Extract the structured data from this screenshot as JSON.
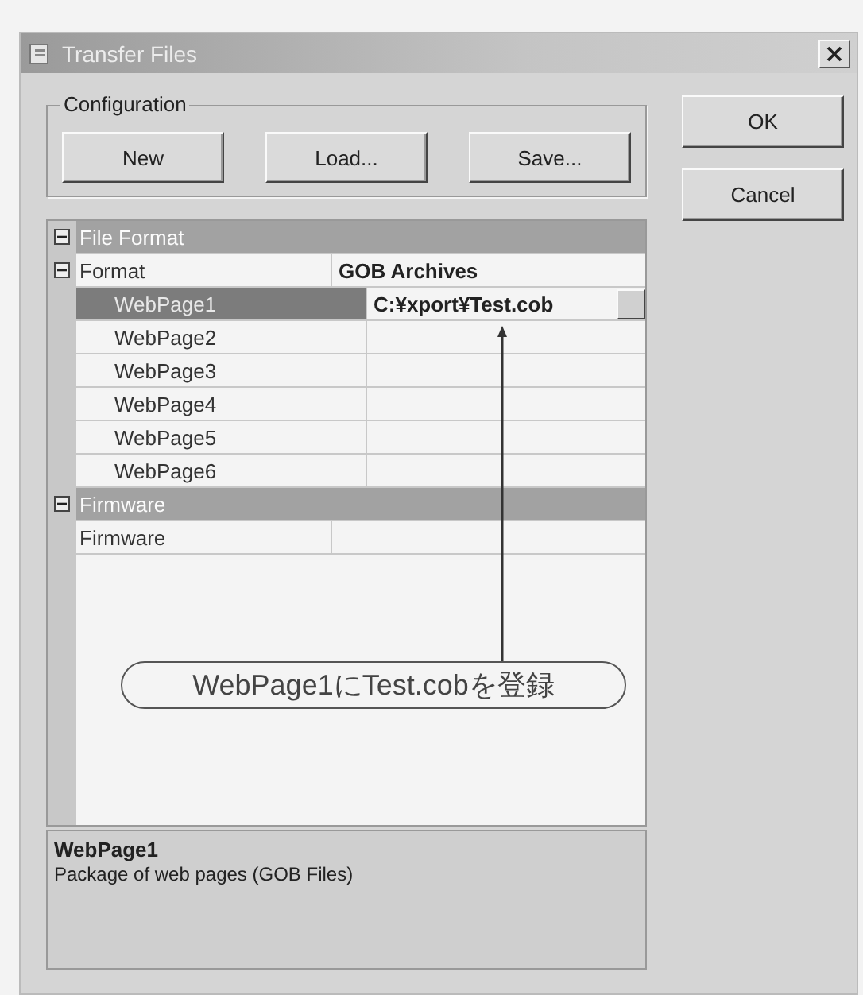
{
  "window": {
    "title": "Transfer Files"
  },
  "configuration": {
    "label": "Configuration",
    "buttons": [
      "New",
      "Load...",
      "Save..."
    ]
  },
  "dialog_buttons": [
    "OK",
    "Cancel"
  ],
  "property_grid": {
    "items": [
      {
        "kind": "category",
        "label": "File Format",
        "expanded": true,
        "children": [
          {
            "kind": "property",
            "label": "Format",
            "value": "GOB Archives",
            "expanded": true,
            "selected": false,
            "children": [
              {
                "kind": "property",
                "label": "WebPage1",
                "value": "C:¥xport¥Test.cob",
                "selected": true
              },
              {
                "kind": "property",
                "label": "WebPage2",
                "selected": false
              },
              {
                "kind": "property",
                "label": "WebPage3",
                "selected": false
              },
              {
                "kind": "property",
                "label": "WebPage4",
                "selected": false
              },
              {
                "kind": "property",
                "label": "WebPage5",
                "selected": false
              },
              {
                "kind": "property",
                "label": "WebPage6",
                "selected": false
              }
            ]
          }
        ]
      },
      {
        "kind": "category",
        "label": "Firmware",
        "expanded": true,
        "children": [
          {
            "kind": "property",
            "label": "Firmware",
            "selected": false
          }
        ]
      }
    ]
  },
  "annotation": {
    "text": "WebPage1にTest.cobを登録"
  },
  "description": {
    "title": "WebPage1",
    "text": "Package of web pages (GOB Files)"
  }
}
